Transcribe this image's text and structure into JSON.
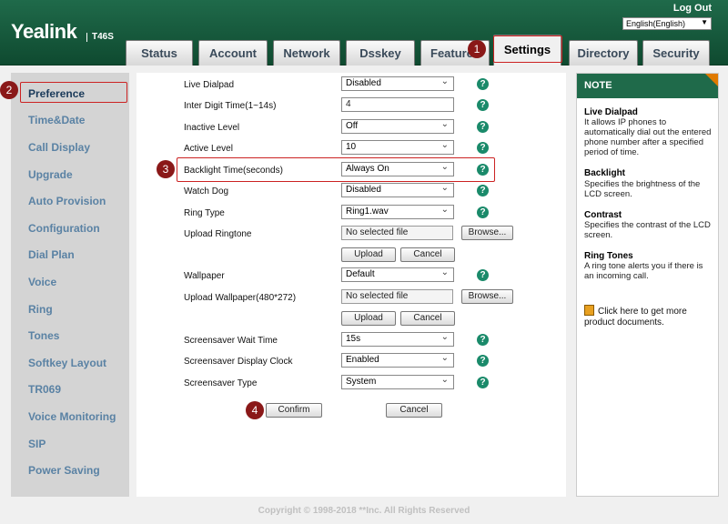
{
  "header": {
    "brand": "Yealink",
    "model": "T46S",
    "logout": "Log Out",
    "language": "English(English)"
  },
  "tabs": [
    {
      "label": "Status"
    },
    {
      "label": "Account"
    },
    {
      "label": "Network"
    },
    {
      "label": "Dsskey"
    },
    {
      "label": "Features"
    },
    {
      "label": "Settings",
      "active": true
    },
    {
      "label": "Directory"
    },
    {
      "label": "Security"
    }
  ],
  "sidebar": {
    "items": [
      {
        "label": "Preference",
        "active": true
      },
      {
        "label": "Time&Date"
      },
      {
        "label": "Call Display"
      },
      {
        "label": "Upgrade"
      },
      {
        "label": "Auto Provision"
      },
      {
        "label": "Configuration"
      },
      {
        "label": "Dial Plan"
      },
      {
        "label": "Voice"
      },
      {
        "label": "Ring"
      },
      {
        "label": "Tones"
      },
      {
        "label": "Softkey Layout"
      },
      {
        "label": "TR069"
      },
      {
        "label": "Voice Monitoring"
      },
      {
        "label": "SIP"
      },
      {
        "label": "Power Saving"
      }
    ]
  },
  "form": {
    "live_dialpad": {
      "label": "Live Dialpad",
      "value": "Disabled"
    },
    "inter_digit": {
      "label": "Inter Digit Time(1~14s)",
      "value": "4"
    },
    "inactive_level": {
      "label": "Inactive Level",
      "value": "Off"
    },
    "active_level": {
      "label": "Active Level",
      "value": "10"
    },
    "backlight_time": {
      "label": "Backlight Time(seconds)",
      "value": "Always On"
    },
    "watch_dog": {
      "label": "Watch Dog",
      "value": "Disabled"
    },
    "ring_type": {
      "label": "Ring Type",
      "value": "Ring1.wav"
    },
    "upload_ringtone": {
      "label": "Upload Ringtone",
      "file": "No selected file",
      "browse": "Browse...",
      "upload": "Upload",
      "cancel": "Cancel"
    },
    "wallpaper": {
      "label": "Wallpaper",
      "value": "Default"
    },
    "upload_wallpaper": {
      "label": "Upload Wallpaper(480*272)",
      "file": "No selected file",
      "browse": "Browse...",
      "upload": "Upload",
      "cancel": "Cancel"
    },
    "screensaver_wait": {
      "label": "Screensaver Wait Time",
      "value": "15s"
    },
    "screensaver_clock": {
      "label": "Screensaver Display Clock",
      "value": "Enabled"
    },
    "screensaver_type": {
      "label": "Screensaver Type",
      "value": "System"
    },
    "confirm": "Confirm",
    "cancel": "Cancel"
  },
  "note": {
    "title": "NOTE",
    "sections": [
      {
        "heading": "Live Dialpad",
        "text": "It allows IP phones to automatically dial out the entered phone number after a specified period of time."
      },
      {
        "heading": "Backlight",
        "text": "Specifies the brightness of the LCD screen."
      },
      {
        "heading": "Contrast",
        "text": "Specifies the contrast of the LCD screen."
      },
      {
        "heading": "Ring Tones",
        "text": "A ring tone alerts you if there is an incoming call."
      }
    ],
    "link": "Click here to get more product documents."
  },
  "badges": [
    "1",
    "2",
    "3",
    "4"
  ],
  "copyright": "Copyright © 1998-2018 **Inc. All Rights Reserved",
  "colors": {
    "header": "#1f6a4a",
    "nav_link": "#5a82a4",
    "help": "#1a8a6a",
    "annotation": "#cc2222"
  }
}
